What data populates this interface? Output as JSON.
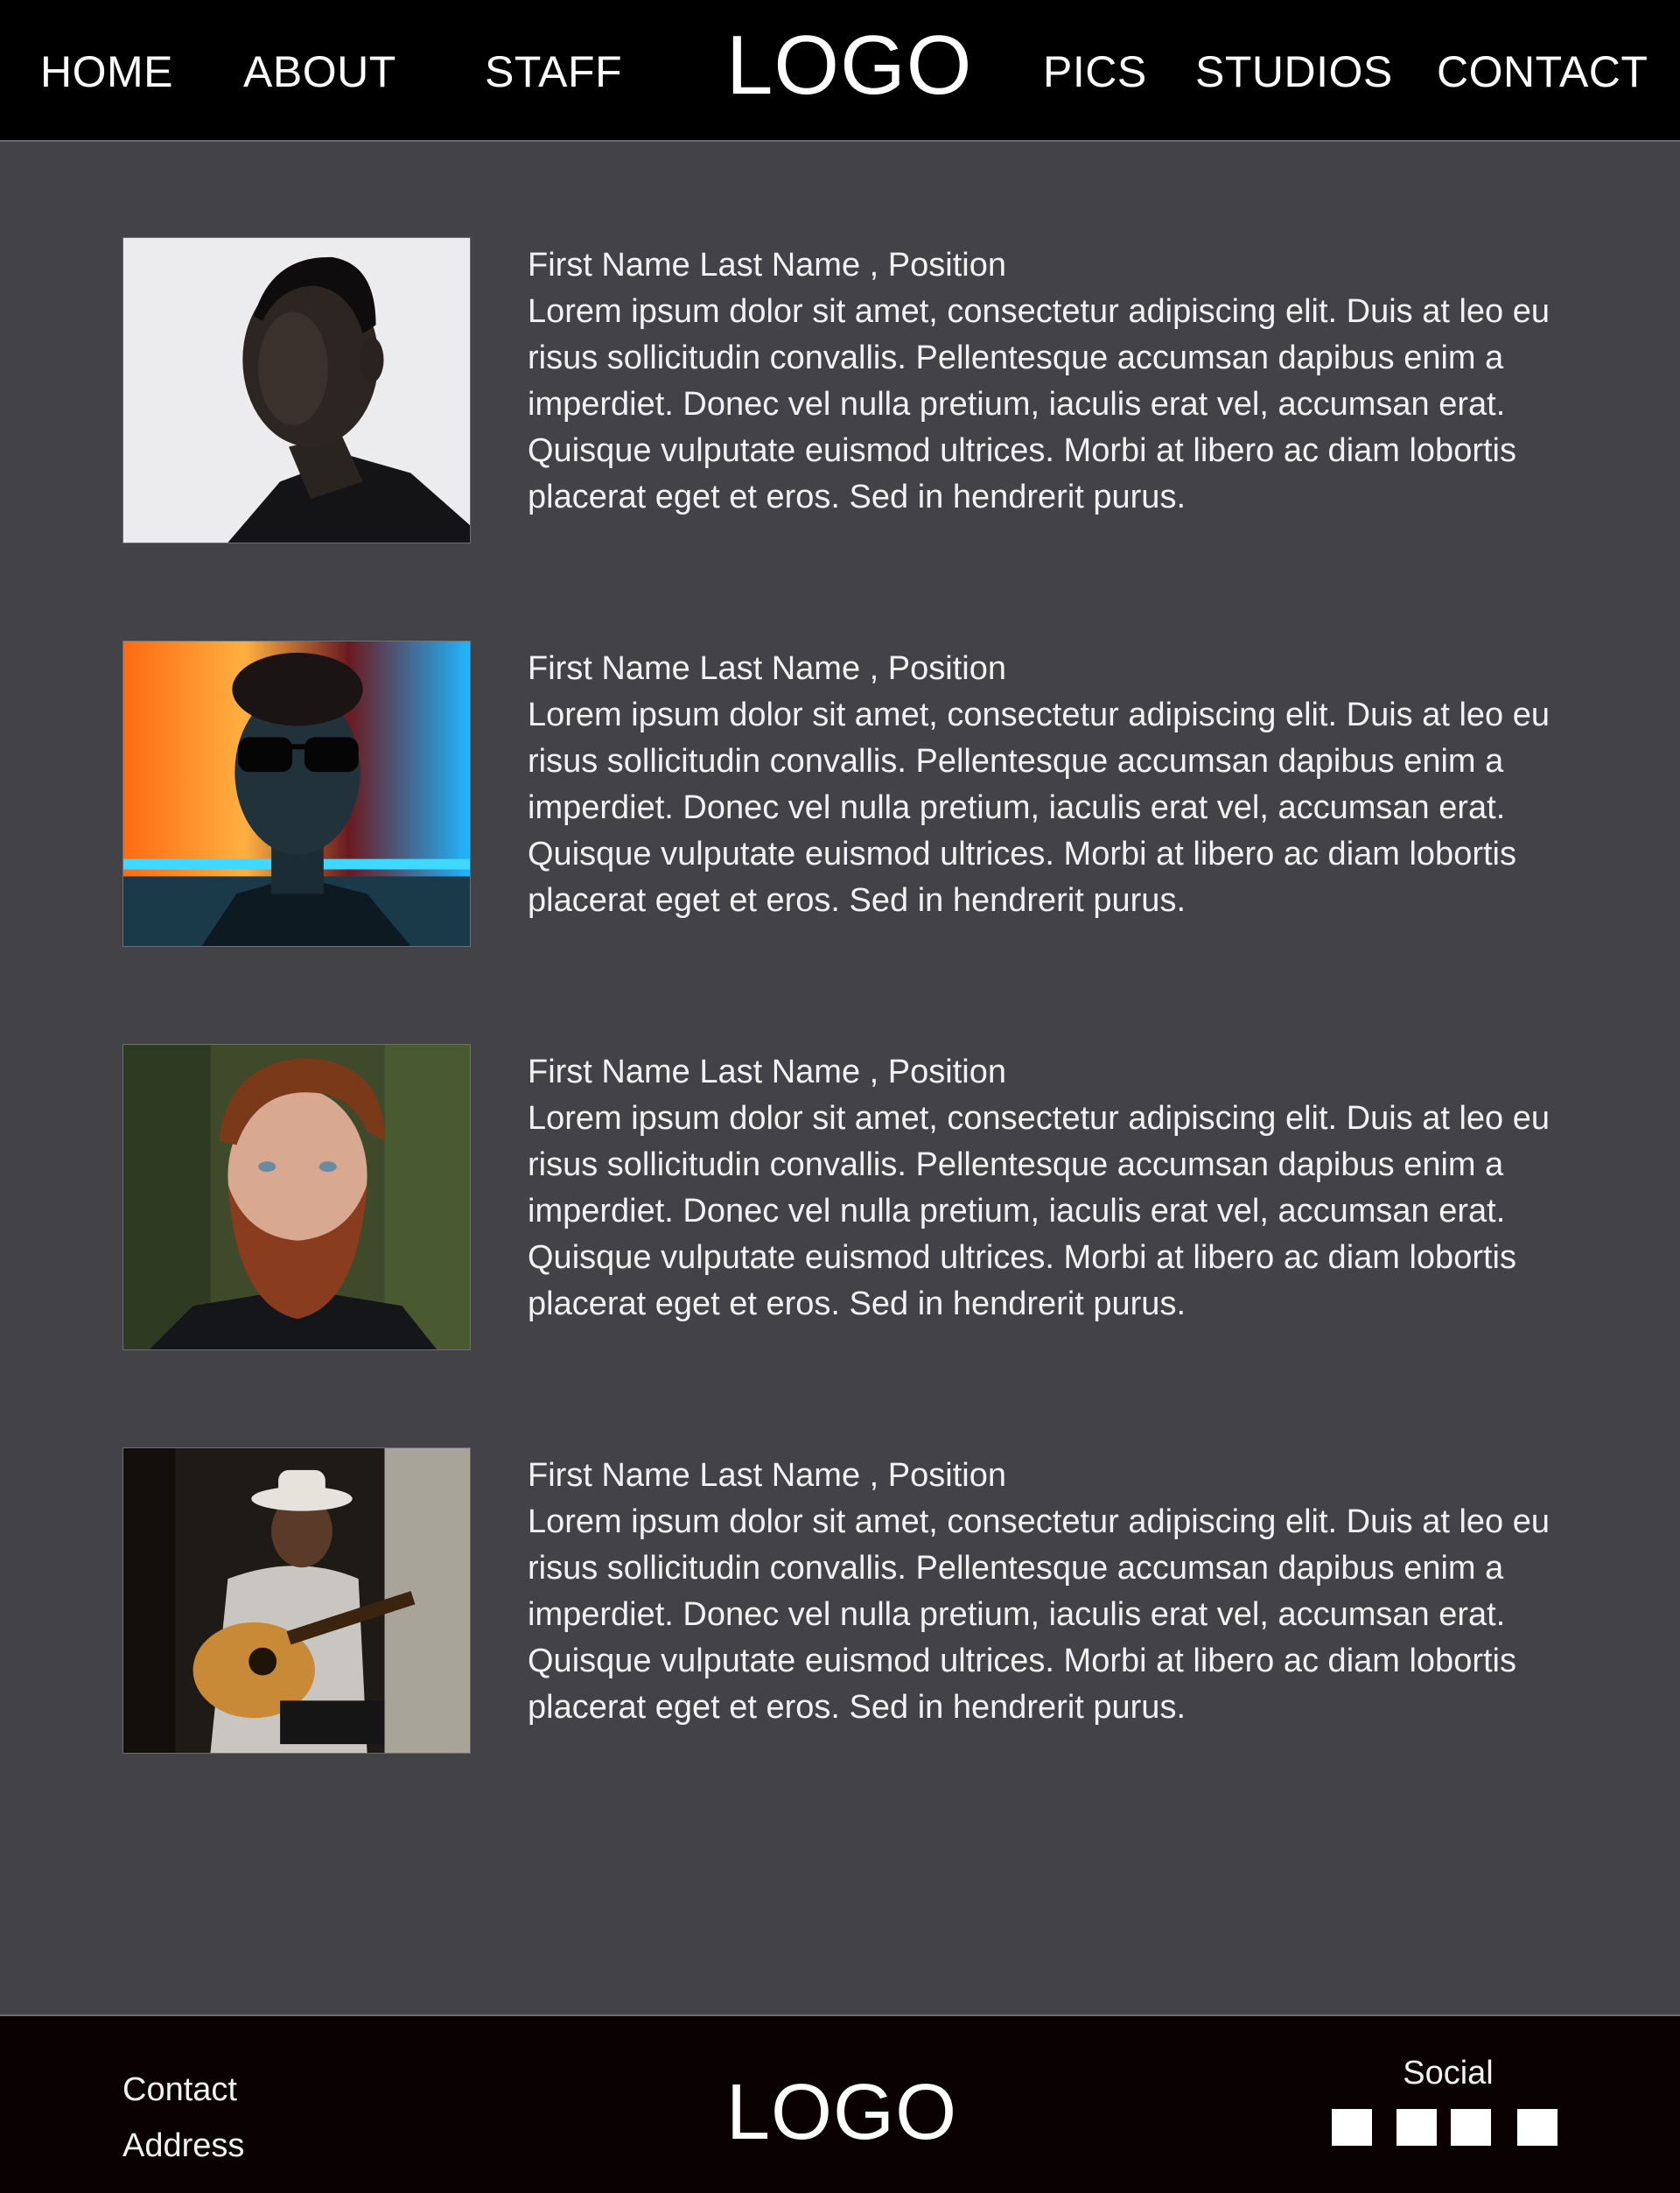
{
  "nav": {
    "home": "HOME",
    "about": "ABOUT",
    "staff": "STAFF",
    "logo": "LOGO",
    "pics": "PICS",
    "studios": "STUDIOS",
    "contact": "CONTACT"
  },
  "staff": [
    {
      "name": "First Name Last Name , Position",
      "bio": "Lorem ipsum dolor sit amet, consectetur adipiscing elit. Duis at leo eu risus sollicitudin convallis. Pellentesque accumsan dapibus enim a imperdiet. Donec vel nulla pretium, iaculis erat vel, accumsan erat. Quisque vulputate euismod ultrices. Morbi at libero ac diam lobortis placerat eget et eros. Sed in hendrerit purus."
    },
    {
      "name": "First Name Last Name , Position",
      "bio": "Lorem ipsum dolor sit amet, consectetur adipiscing elit. Duis at leo eu risus sollicitudin convallis. Pellentesque accumsan dapibus enim a imperdiet. Donec vel nulla pretium, iaculis erat vel, accumsan erat. Quisque vulputate euismod ultrices. Morbi at libero ac diam lobortis placerat eget et eros. Sed in hendrerit purus."
    },
    {
      "name": "First Name Last Name , Position",
      "bio": "Lorem ipsum dolor sit amet, consectetur adipiscing elit. Duis at leo eu risus sollicitudin convallis. Pellentesque accumsan dapibus enim a imperdiet. Donec vel nulla pretium, iaculis erat vel, accumsan erat. Quisque vulputate euismod ultrices. Morbi at libero ac diam lobortis placerat eget et eros. Sed in hendrerit purus."
    },
    {
      "name": "First Name Last Name , Position",
      "bio": "Lorem ipsum dolor sit amet, consectetur adipiscing elit. Duis at leo eu risus sollicitudin convallis. Pellentesque accumsan dapibus enim a imperdiet. Donec vel nulla pretium, iaculis erat vel, accumsan erat. Quisque vulputate euismod ultrices. Morbi at libero ac diam lobortis placerat eget et eros. Sed in hendrerit purus."
    }
  ],
  "footer": {
    "contact": "Contact",
    "address": "Address",
    "logo": "LOGO",
    "social_label": "Social",
    "social_icons": [
      "social-icon",
      "social-icon",
      "social-icon",
      "social-icon"
    ]
  },
  "colors": {
    "header_bg": "#000000",
    "body_bg": "#434246",
    "footer_bg": "#0a0103",
    "text": "#ffffff"
  }
}
